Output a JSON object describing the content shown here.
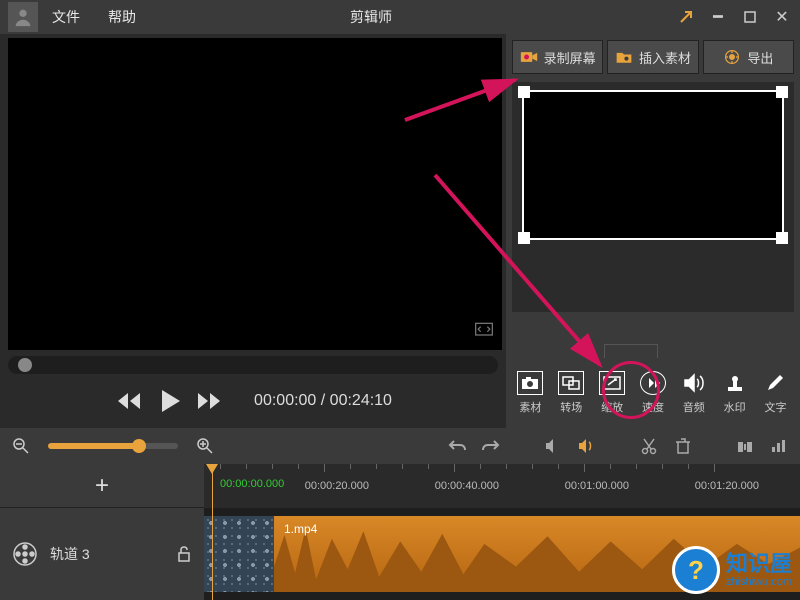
{
  "titlebar": {
    "menu_file": "文件",
    "menu_help": "帮助",
    "app_title": "剪辑师"
  },
  "right_top": {
    "record": "录制屏幕",
    "insert": "插入素材",
    "export": "导出"
  },
  "transport": {
    "current": "00:00:00",
    "duration": "00:24:10"
  },
  "tools": {
    "material": "素材",
    "transition": "转场",
    "zoom": "缩放",
    "speed": "速度",
    "audio": "音频",
    "watermark": "水印",
    "text": "文字"
  },
  "timeline": {
    "track_label": "轨道 3",
    "playhead_time": "00:00:00.000",
    "ruler": [
      "00:00:20.000",
      "00:00:40.000",
      "00:01:00.000",
      "00:01:20.000"
    ],
    "clip_name": "1.mp4"
  },
  "watermark": {
    "line1": "知识屋",
    "line2": "zhishiwu.com"
  }
}
